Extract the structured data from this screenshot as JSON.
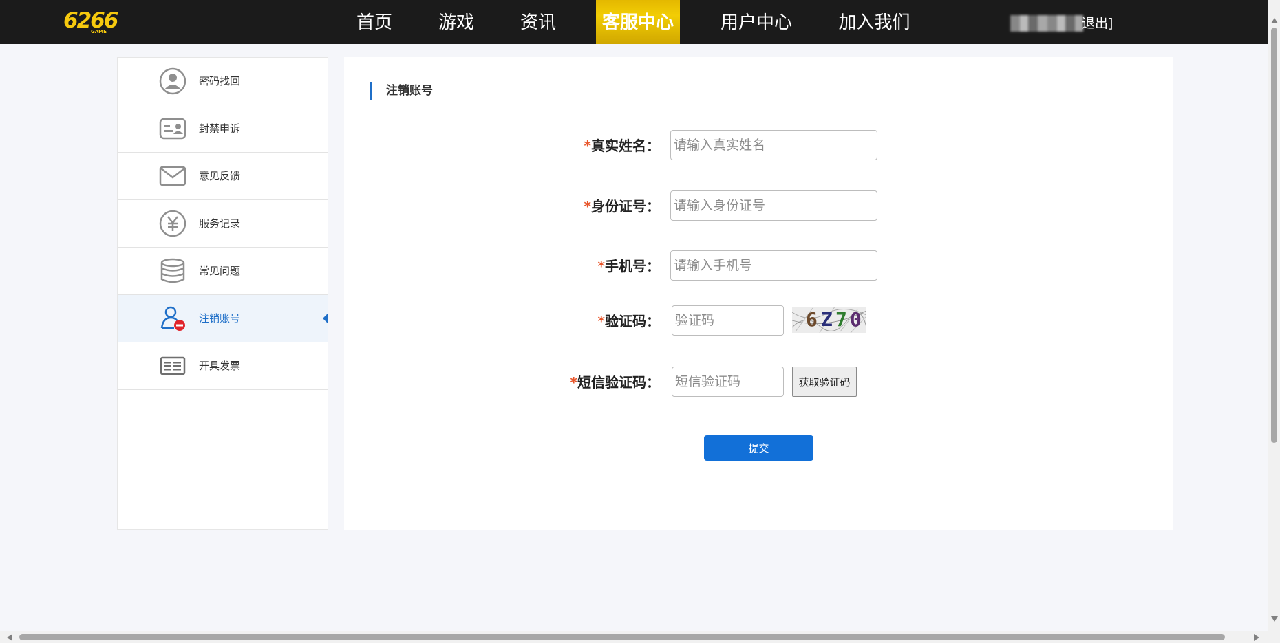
{
  "header": {
    "logo_text": "6266",
    "logo_sub": "GAME",
    "nav": [
      {
        "label": "首页",
        "active": false
      },
      {
        "label": "游戏",
        "active": false
      },
      {
        "label": "资讯",
        "active": false
      },
      {
        "label": "客服中心",
        "active": true
      },
      {
        "label": "用户中心",
        "active": false
      },
      {
        "label": "加入我们",
        "active": false
      }
    ],
    "logout_label": "退出]"
  },
  "sidebar": {
    "items": [
      {
        "label": "密码找回",
        "icon": "user-circle-icon",
        "active": false
      },
      {
        "label": "封禁申诉",
        "icon": "id-card-icon",
        "active": false
      },
      {
        "label": "意见反馈",
        "icon": "mail-icon",
        "active": false
      },
      {
        "label": "服务记录",
        "icon": "yen-icon",
        "active": false
      },
      {
        "label": "常见问题",
        "icon": "database-icon",
        "active": false
      },
      {
        "label": "注销账号",
        "icon": "user-remove-icon",
        "active": true
      },
      {
        "label": "开具发票",
        "icon": "invoice-icon",
        "active": false
      }
    ]
  },
  "main": {
    "title": "注销账号",
    "form": {
      "required_mark": "*",
      "real_name": {
        "label": "真实姓名：",
        "placeholder": "请输入真实姓名",
        "value": ""
      },
      "id_number": {
        "label": "身份证号：",
        "placeholder": "请输入身份证号",
        "value": ""
      },
      "phone": {
        "label": "手机号：",
        "placeholder": "请输入手机号",
        "value": ""
      },
      "captcha": {
        "label": "验证码：",
        "placeholder": "验证码",
        "value": "",
        "image_text": [
          "6",
          "Z",
          "7",
          "0"
        ]
      },
      "sms_code": {
        "label": "短信验证码：",
        "placeholder": "短信验证码",
        "value": "",
        "button_label": "获取验证码"
      },
      "submit_label": "提交"
    }
  },
  "colors": {
    "header_bg": "#1b1b1b",
    "nav_active": "#f2cd05",
    "accent": "#1270d8",
    "required": "#e8552a",
    "page_bg": "#f5f6fa"
  }
}
